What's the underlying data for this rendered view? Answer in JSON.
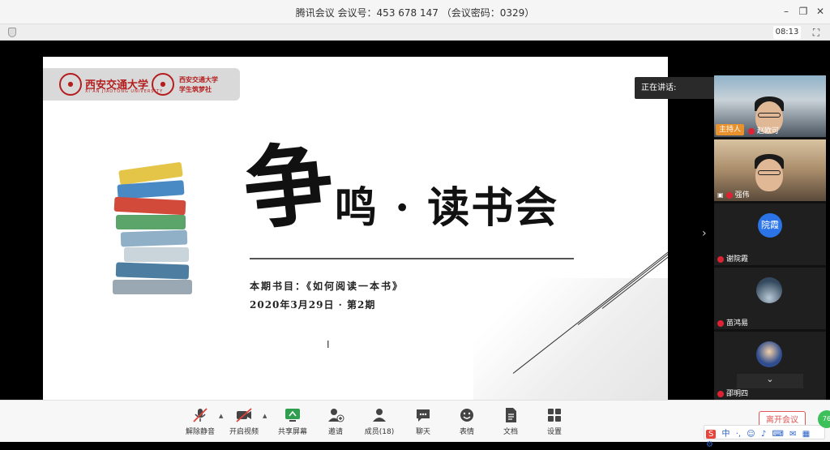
{
  "titlebar": {
    "title": "腾讯会议 会议号：453 678 147 （会议密码：0329）",
    "minimize": "–",
    "restore": "❐",
    "close": "✕"
  },
  "infobar": {
    "timer": "08:13",
    "fullscreen_icon": "fullscreen-icon"
  },
  "slide": {
    "school_name": "西安交通大学",
    "school_sub": "XI'AN JIAOTONG UNIVERSITY",
    "club_name_1": "西安交通大学",
    "club_name_2": "学生筑梦社",
    "title_char": "争",
    "title_rest": "鸣 · 读书会",
    "book_line": "本期书目：《如何阅读一本书》",
    "date_line": "2020年3月29日 · 第2期",
    "cursor": "I"
  },
  "speaking": {
    "label": "正在讲话:"
  },
  "participants": [
    {
      "name": "赵欧可",
      "badge": "主持人",
      "type": "video"
    },
    {
      "name": "强伟",
      "type": "video"
    },
    {
      "name": "谢院霞",
      "avatar_text": "院霞",
      "type": "initials",
      "avatar_color": "#2b74e8"
    },
    {
      "name": "苗鸿易",
      "type": "photo"
    },
    {
      "name": "邵明四",
      "type": "photo"
    }
  ],
  "toolbar": {
    "unmute": "解除静音",
    "start_video": "开启视频",
    "share_screen": "共享屏幕",
    "invite": "邀请",
    "members": "成员(18)",
    "chat": "聊天",
    "reactions": "表情",
    "documents": "文档",
    "settings": "设置",
    "leave": "离开会议"
  },
  "ime": {
    "logo": "S",
    "mode": "中",
    "punct": "·,",
    "items": [
      "☺",
      "♪",
      "⌨",
      "✉",
      "▦",
      "⚙"
    ]
  },
  "badge": {
    "value": "76"
  },
  "colors": {
    "accent_red": "#e05555",
    "host_orange": "#e8912d",
    "avatar_blue": "#2b74e8",
    "school_red": "#b41e1e"
  }
}
